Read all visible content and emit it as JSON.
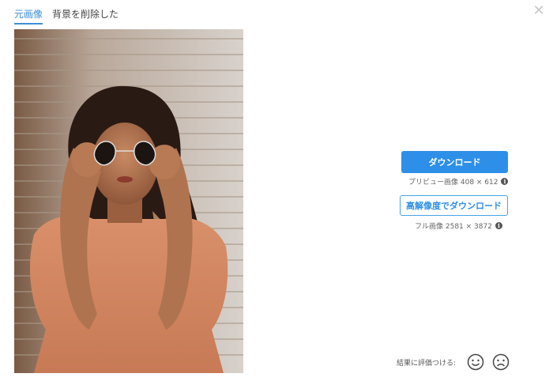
{
  "tabs": [
    {
      "label": "元画像",
      "active": true
    },
    {
      "label": "背景を削除した",
      "active": false
    }
  ],
  "close_icon": "close-icon",
  "image": {
    "description_icon": "photo"
  },
  "download": {
    "button_label": "ダウンロード",
    "preview_text": "プリビュー画像 408 × 612"
  },
  "hd_download": {
    "button_label": "高解像度でダウンロード",
    "full_text": "フル画像 2581 × 3872"
  },
  "rating": {
    "label": "結果に評価つける:",
    "happy_icon": "smile-icon",
    "sad_icon": "frown-icon"
  },
  "colors": {
    "accent": "#2d8fe8",
    "tab_active": "#3d8fd8"
  }
}
